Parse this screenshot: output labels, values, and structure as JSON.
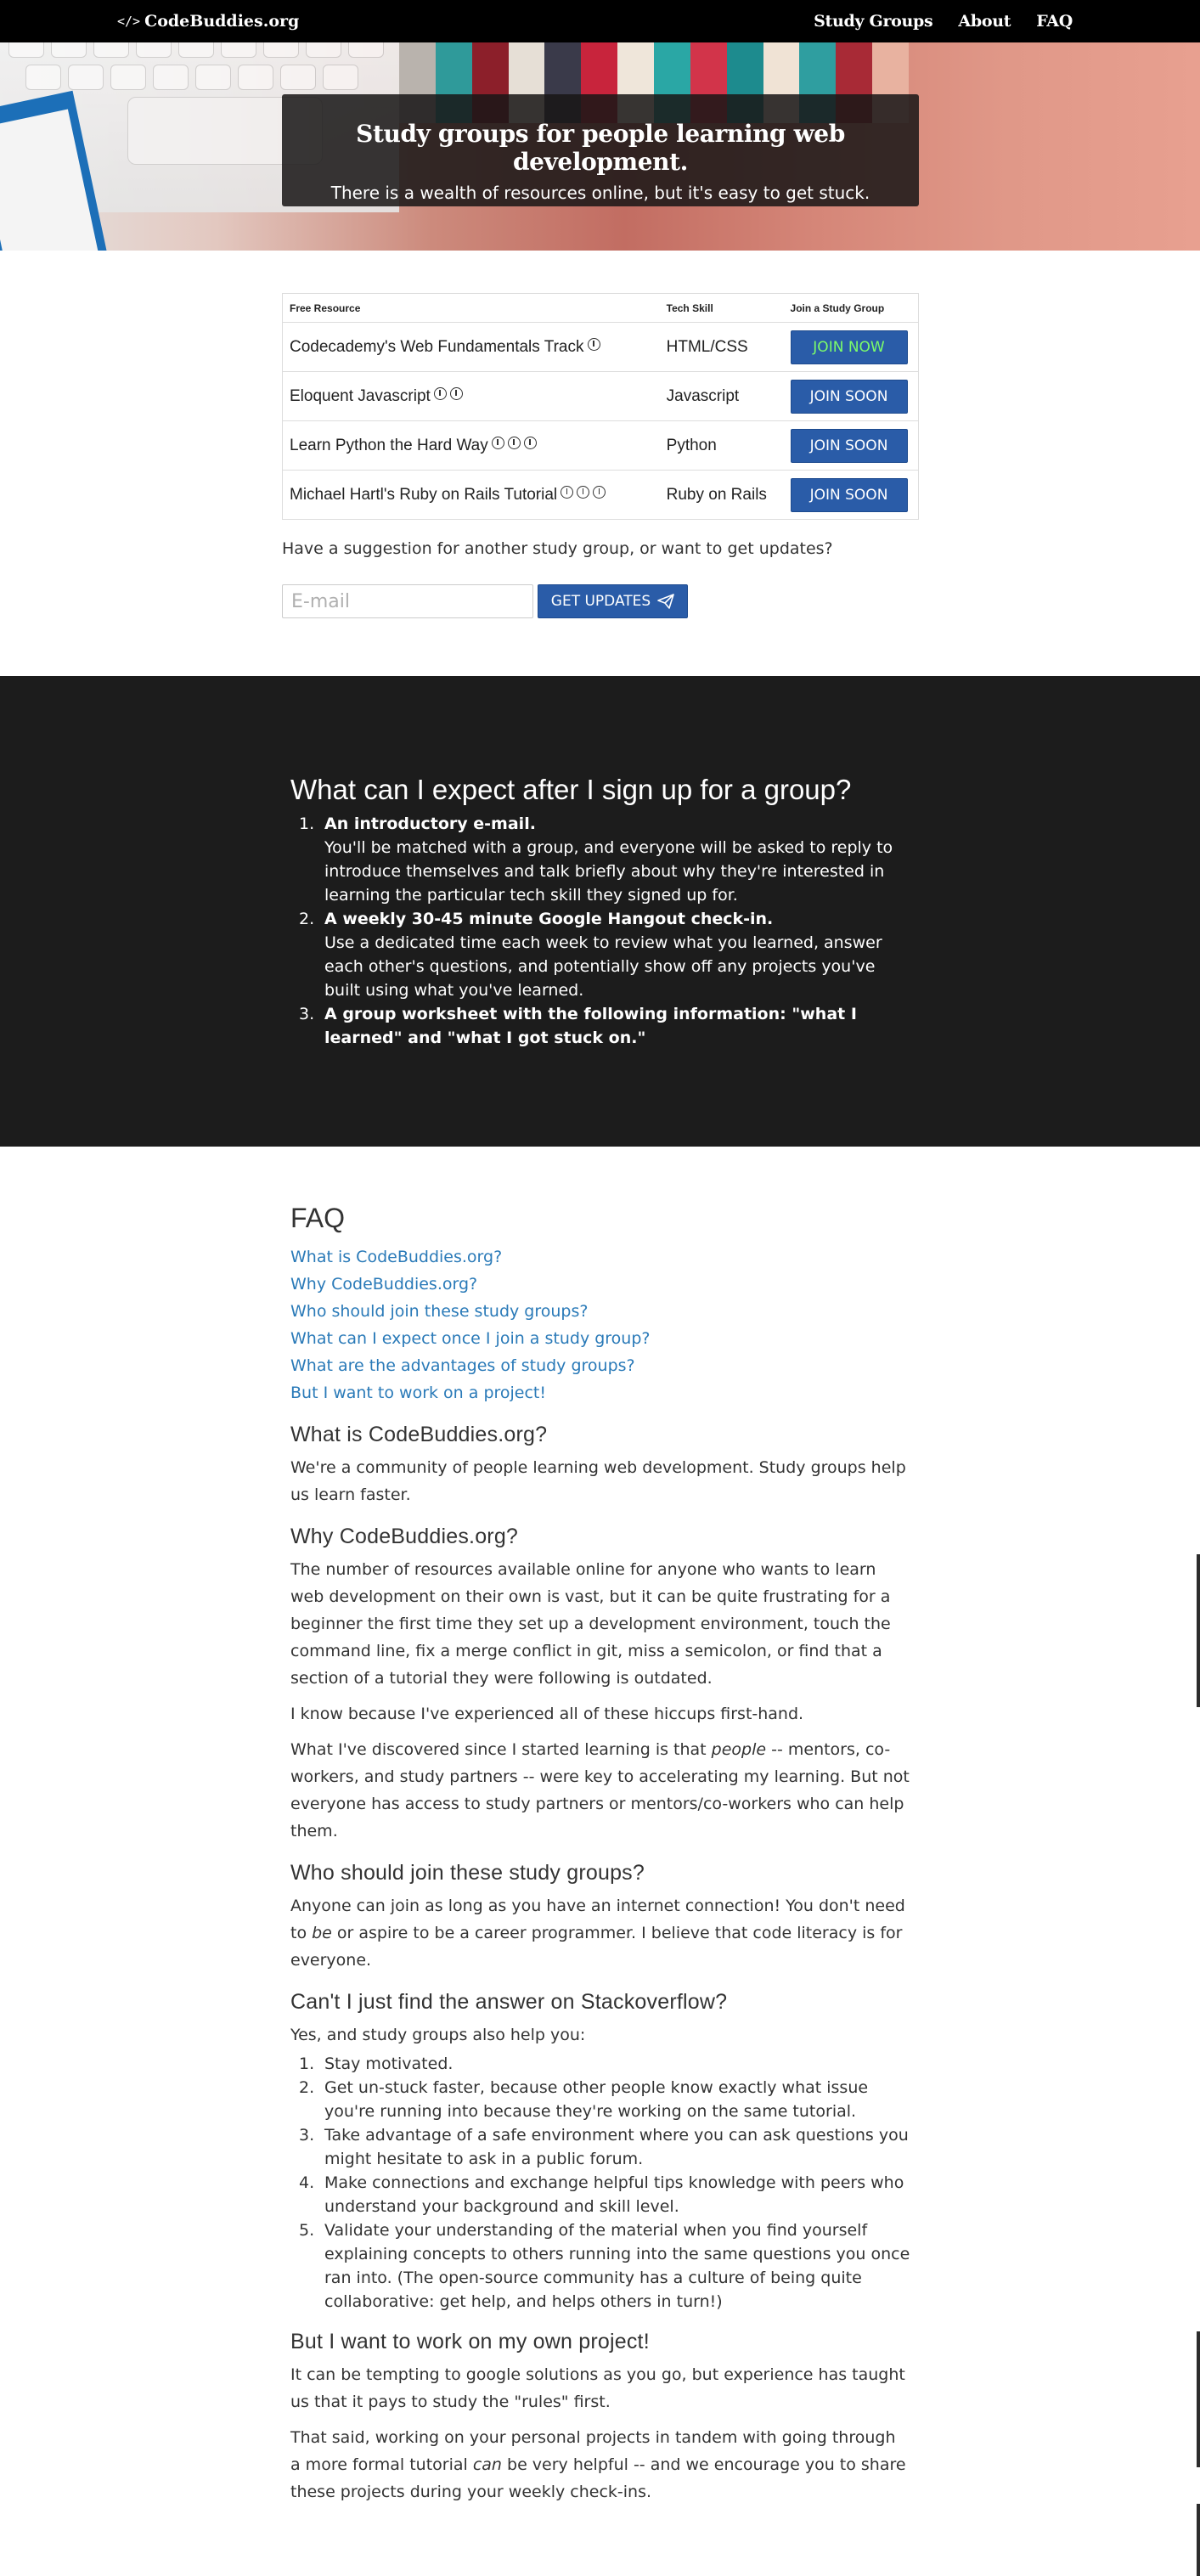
{
  "nav": {
    "brand_icon": "</>",
    "brand": "CodeBuddies.org",
    "links": [
      "Study Groups",
      "About",
      "FAQ"
    ]
  },
  "hero": {
    "title": "Study groups for people learning web development.",
    "subtitle": "There is a wealth of resources online, but it's easy to get stuck."
  },
  "table": {
    "headers": [
      "Free Resource",
      "Tech Skill",
      "Join a Study Group"
    ],
    "rows": [
      {
        "resource": "Codecademy's Web Fundamentals Track",
        "info_icons": 1,
        "skill": "HTML/CSS",
        "button": "JOIN NOW"
      },
      {
        "resource": "Eloquent Javascript",
        "info_icons": 2,
        "skill": "Javascript",
        "button": "JOIN SOON"
      },
      {
        "resource": "Learn Python the Hard Way",
        "info_icons": 3,
        "skill": "Python",
        "button": "JOIN SOON"
      },
      {
        "resource": "Michael Hartl's Ruby on Rails Tutorial",
        "info_icons": 3,
        "skill": "Ruby on Rails",
        "button": "JOIN SOON"
      }
    ],
    "icon": "info-circle-icon"
  },
  "signup": {
    "prompt": "Have a suggestion for another study group, or want to get updates?",
    "email_placeholder": "E-mail",
    "button": "GET UPDATES",
    "button_icon": "paper-plane-icon"
  },
  "expect": {
    "title": "What can I expect after I sign up for a group?",
    "items": [
      {
        "num": "1.",
        "head": "An introductory e-mail.",
        "body": "You'll be matched with a group, and everyone will be asked to reply to introduce themselves and talk briefly about why they're interested in learning the particular tech skill they signed up for."
      },
      {
        "num": "2.",
        "head": "A weekly 30-45 minute Google Hangout check-in.",
        "body": "Use a dedicated time each week to review what you learned, answer each other's questions, and potentially show off any projects you've built using what you've learned."
      },
      {
        "num": "3.",
        "head": "A group worksheet with the following information: \"what I learned\" and \"what I got stuck on.\"",
        "body": ""
      }
    ]
  },
  "faq": {
    "title": "FAQ",
    "links": [
      "What is CodeBuddies.org?",
      "Why CodeBuddies.org?",
      "Who should join these study groups?",
      "What can I expect once I join a study group?",
      "What are the advantages of study groups?",
      "But I want to work on a project!"
    ],
    "what": {
      "q": "What is CodeBuddies.org?",
      "a": "We're a community of people learning web development. Study groups help us learn faster."
    },
    "why": {
      "q": "Why CodeBuddies.org?",
      "p1": "The number of resources available online for anyone who wants to learn web development on their own is vast, but it can be quite frustrating for a beginner the first time they set up a development environment, touch the command line, fix a merge conflict in git, miss a semicolon, or find that a section of a tutorial they were following is outdated.",
      "p2": "I know because I've experienced all of these hiccups first-hand.",
      "p3_a": "What I've discovered since I started learning is that ",
      "p3_em": "people",
      "p3_b": " -- mentors, co-workers, and study partners -- were key to accelerating my learning. But not everyone has access to study partners or mentors/co-workers who can help them."
    },
    "who": {
      "q": "Who should join these study groups?",
      "a_1": "Anyone can join as long as you have an internet connection! You don't need to ",
      "a_em": "be",
      "a_2": " or aspire to be a career programmer. I believe that code literacy is for everyone."
    },
    "stack": {
      "q": "Can't I just find the answer on Stackoverflow?",
      "intro": "Yes, and study groups also help you:",
      "items": [
        {
          "num": "1.",
          "text": "Stay motivated."
        },
        {
          "num": "2.",
          "text": "Get un-stuck faster, because other people know exactly what issue you're running into because they're working on the same tutorial."
        },
        {
          "num": "3.",
          "text": "Take advantage of a safe environment where you can ask questions you might hesitate to ask in a public forum."
        },
        {
          "num": "4.",
          "text": "Make connections and exchange helpful tips knowledge with peers who understand your background and skill level."
        },
        {
          "num": "5.",
          "text": "Validate your understanding of the material when you find yourself explaining concepts to others running into the same questions you once ran into. (The open-source community has a culture of being quite collaborative: get help, and helps others in turn!)"
        }
      ]
    },
    "project": {
      "q": "But I want to work on my own project!",
      "p1": "It can be tempting to google solutions as you go, but experience has taught us that it pays to study the \"rules\" first.",
      "p2_a": "That said, working on your personal projects in tandem with going through a more formal tutorial ",
      "p2_em": "can",
      "p2_b": " be very helpful -- and we encourage you to share these projects during your weekly check-ins."
    }
  },
  "colors": {
    "nav_bg": "#000000",
    "button_blue": "#2a5ca8",
    "join_now_text": "#7cfc6a",
    "link_blue": "#2a7ab8",
    "dark_section": "#1c1c1c"
  }
}
